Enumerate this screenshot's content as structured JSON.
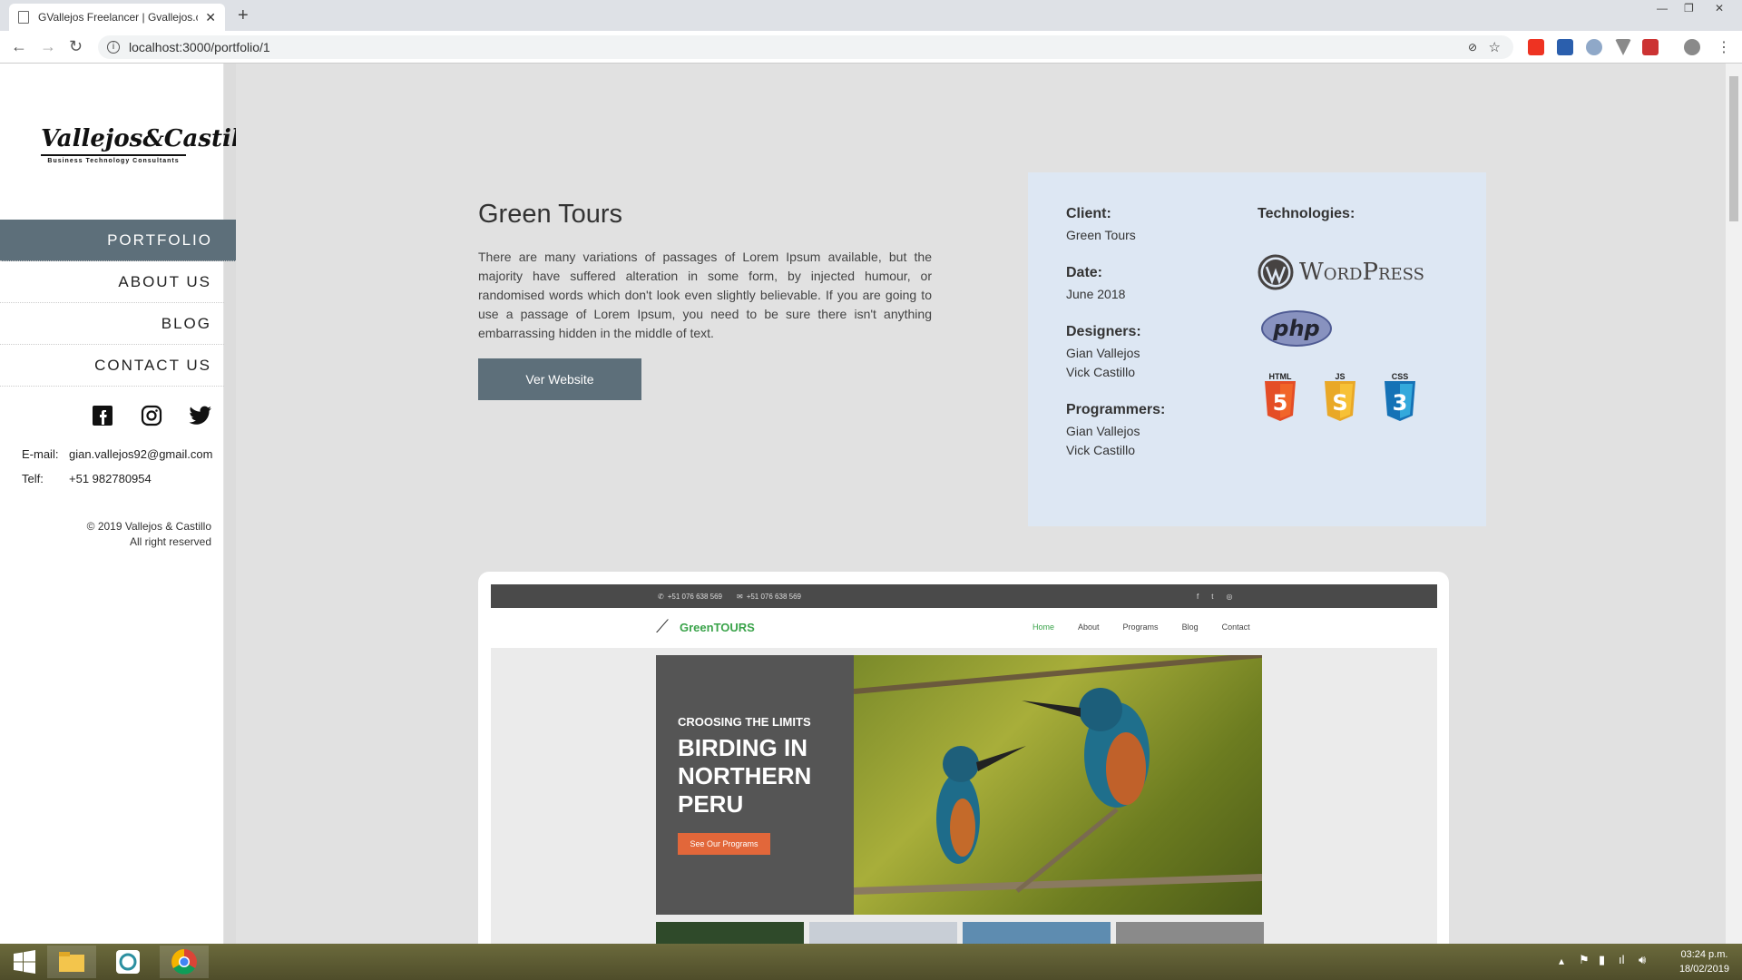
{
  "browser": {
    "tab_title": "GVallejos Freelancer | Gvallejos.c",
    "url": "localhost:3000/portfolio/1"
  },
  "sidebar": {
    "logo_main": "Vallejos&Castillo",
    "logo_sub": "Business Technology Consultants",
    "nav": [
      "PORTFOLIO",
      "ABOUT US",
      "BLOG",
      "CONTACT US"
    ],
    "email_label": "E-mail:",
    "email": "gian.vallejos92@gmail.com",
    "phone_label": "Telf:",
    "phone": "+51 982780954",
    "copyright_line1": "© 2019 Vallejos & Castillo",
    "copyright_line2": "All right reserved"
  },
  "project": {
    "title": "Green Tours",
    "description": "There are many variations of passages of Lorem Ipsum available, but the majority have suffered alteration in some form, by injected humour, or randomised words which don't look even slightly believable. If you are going to use a passage of Lorem Ipsum, you need to be sure there isn't anything embarrassing hidden in the middle of text.",
    "button": "Ver Website"
  },
  "details": {
    "client_label": "Client:",
    "client": "Green Tours",
    "date_label": "Date:",
    "date": "June 2018",
    "designers_label": "Designers:",
    "designers": [
      "Gian Vallejos",
      "Vick Castillo"
    ],
    "programmers_label": "Programmers:",
    "programmers": [
      "Gian Vallejos",
      "Vick Castillo"
    ],
    "technologies_label": "Technologies:",
    "tech_wordpress": "WordPress",
    "tech_php": "php",
    "tech_html": "HTML",
    "tech_js": "JS",
    "tech_css": "CSS"
  },
  "preview": {
    "phone1": "+51 076 638 569",
    "phone2": "+51 076 638 569",
    "brand": "GreenTOURS",
    "nav": [
      "Home",
      "About",
      "Programs",
      "Blog",
      "Contact"
    ],
    "hero_kicker": "CROOSING THE LIMITS",
    "hero_title_1": "BIRDING IN",
    "hero_title_2": "NORTHERN",
    "hero_title_3": "PERU",
    "hero_button": "See Our Programs"
  },
  "taskbar": {
    "time": "03:24 p.m.",
    "date": "18/02/2019"
  },
  "colors": {
    "accent": "#5d6f7a",
    "panel": "#dde7f3",
    "brand_green": "#3aa34a",
    "cta_orange": "#e2673a"
  }
}
